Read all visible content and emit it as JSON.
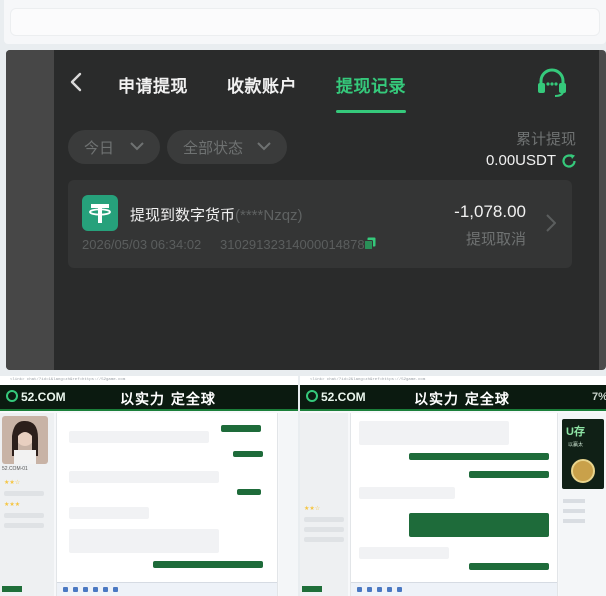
{
  "nav": {
    "tabs": [
      {
        "label": "申请提现"
      },
      {
        "label": "收款账户"
      },
      {
        "label": "提现记录"
      }
    ],
    "active_tab": "提现记录"
  },
  "filters": {
    "date": "今日",
    "status": "全部状态"
  },
  "summary": {
    "label": "累计提现",
    "value": "0.00USDT"
  },
  "record": {
    "title": "提现到数字货币",
    "masked_account": "(****Nzqz)",
    "datetime": "2026/05/03 06:34:02",
    "order_no": "310291323140000148789",
    "amount": "-1,078.00",
    "status": "提现取消"
  },
  "chat_shots": {
    "left": {
      "url": "<link> chat/?id=1&lang=zh&ref=https://52game.com",
      "logo": "52.COM",
      "slogan": "以实力 定全球",
      "agent_name": "52.COM-01"
    },
    "right": {
      "url": "<link> chat/?id=2&lang=zh&ref=https://52game.com",
      "logo": "52.COM",
      "slogan": "以实力 定全球",
      "tail": "7%",
      "promo_title": "U存",
      "promo_sub": "以赢太"
    }
  },
  "colors": {
    "accent": "#35c97b",
    "panel_bg": "#2a2b2b",
    "card_bg": "#343535",
    "usdt": "#26a17b",
    "chat_out": "#1e6b3a"
  }
}
